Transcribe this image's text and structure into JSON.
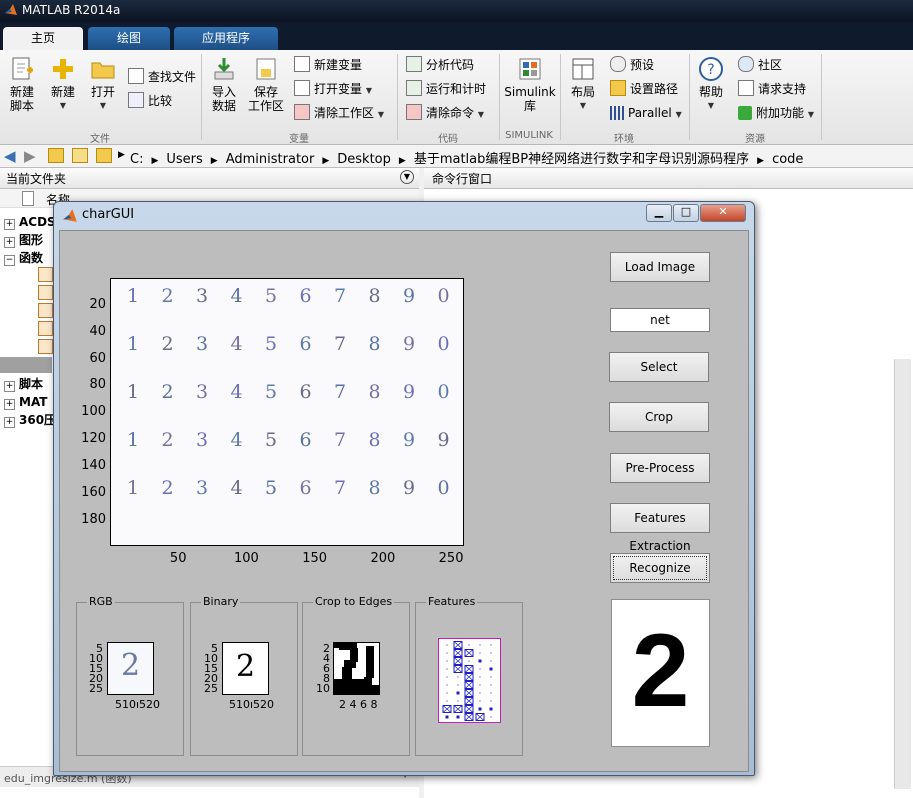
{
  "app": {
    "title": "MATLAB R2014a"
  },
  "tabs": [
    {
      "label": "主页"
    },
    {
      "label": "绘图"
    },
    {
      "label": "应用程序"
    }
  ],
  "toolstrip": {
    "file": {
      "new_script": "新建\n脚本",
      "new": "新建",
      "open": "打开",
      "find_files": "查找文件",
      "compare": "比较",
      "label": "文件"
    },
    "variable": {
      "import": "导入\n数据",
      "save_workspace": "保存\n工作区",
      "new_variable": "新建变量",
      "open_variable": "打开变量",
      "clear_workspace": "清除工作区",
      "label": "变量"
    },
    "code": {
      "analyze": "分析代码",
      "run_and_time": "运行和计时",
      "clear_commands": "清除命令",
      "label": "代码"
    },
    "simulink": {
      "library": "Simulink\n库",
      "label": "SIMULINK"
    },
    "environment": {
      "layout": "布局",
      "preferences": "预设",
      "set_path": "设置路径",
      "parallel": "Parallel",
      "label": "环境"
    },
    "resources": {
      "help": "帮助",
      "community": "社区",
      "request_support": "请求支持",
      "add_ons": "附加功能",
      "label": "资源"
    }
  },
  "address": {
    "crumbs": [
      "C:",
      "Users",
      "Administrator",
      "Desktop",
      "基于matlab编程BP神经网络进行数字和字母识别源码程序",
      "code"
    ]
  },
  "panels": {
    "current_folder": "当前文件夹",
    "command_window": "命令行窗口",
    "name_column": "名称",
    "tree": [
      {
        "label": "ACDS"
      },
      {
        "label": "图形"
      },
      {
        "label": "函数"
      },
      {
        "label": "脚本"
      },
      {
        "label": "MAT"
      },
      {
        "label": "360压"
      }
    ],
    "details": "edu_imgresize.m (函数)"
  },
  "chargui": {
    "title": "charGUI",
    "buttons": {
      "load_image": "Load Image",
      "select": "Select",
      "crop": "Crop",
      "preprocess": "Pre-Process",
      "features": "Features Extraction",
      "recognize": "Recognize"
    },
    "net_field": "net",
    "result": "2",
    "main_axes": {
      "y_ticks": [
        "20",
        "40",
        "60",
        "80",
        "100",
        "120",
        "140",
        "160",
        "180"
      ],
      "x_ticks": [
        "50",
        "100",
        "150",
        "200",
        "250"
      ],
      "digit_rows": [
        [
          "1",
          "2",
          "3",
          "4",
          "5",
          "6",
          "7",
          "8",
          "9",
          "0"
        ],
        [
          "1",
          "2",
          "3",
          "4",
          "5",
          "6",
          "7",
          "8",
          "9",
          "0"
        ],
        [
          "1",
          "2",
          "3",
          "4",
          "5",
          "6",
          "7",
          "8",
          "9",
          "0"
        ],
        [
          "1",
          "2",
          "3",
          "4",
          "5",
          "6",
          "7",
          "8",
          "9",
          "9"
        ],
        [
          "1",
          "2",
          "3",
          "4",
          "5",
          "6",
          "7",
          "8",
          "9",
          "0"
        ]
      ]
    },
    "panels": {
      "rgb": {
        "title": "RGB",
        "y_ticks": [
          "5",
          "10",
          "15",
          "20",
          "25"
        ],
        "x_ticks": "510ı520",
        "glyph": "2"
      },
      "binary": {
        "title": "Binary",
        "y_ticks": [
          "5",
          "10",
          "15",
          "20",
          "25"
        ],
        "x_ticks": "510ı520",
        "glyph": "2"
      },
      "crop": {
        "title": "Crop to Edges",
        "y_ticks": [
          "2",
          "4",
          "6",
          "8",
          "10"
        ],
        "x_ticks": "2 4 6 8"
      },
      "features": {
        "title": "Features"
      }
    }
  }
}
